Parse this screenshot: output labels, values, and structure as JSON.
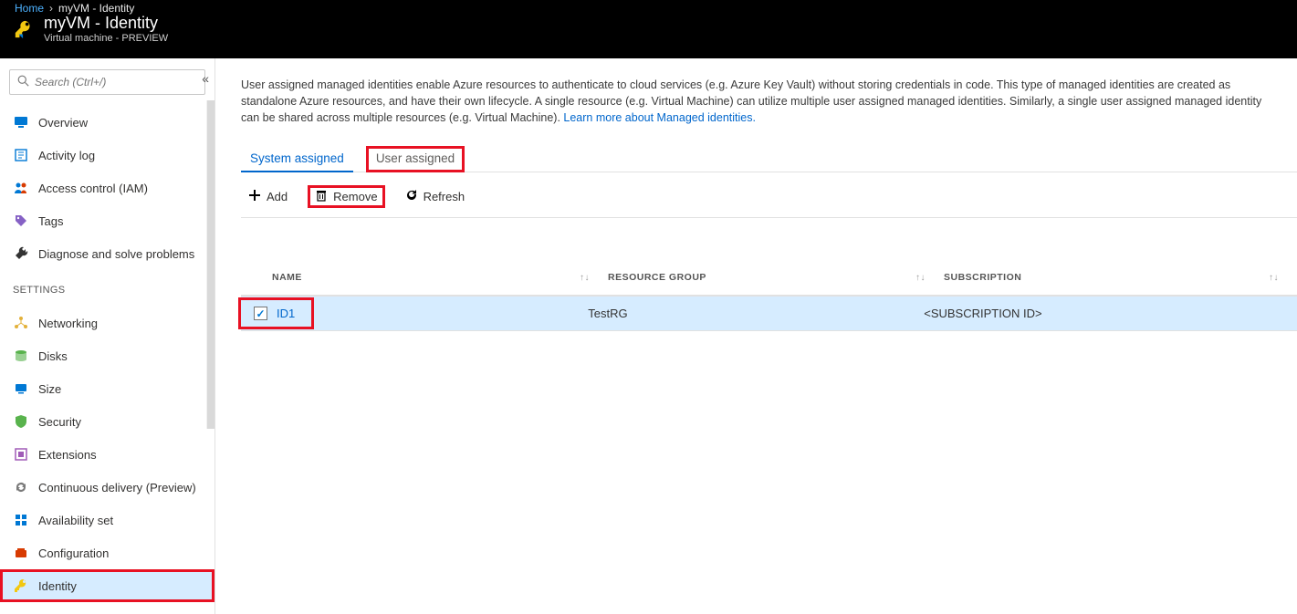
{
  "breadcrumb": {
    "home": "Home",
    "current": "myVM - Identity"
  },
  "header": {
    "title": "myVM - Identity",
    "subtitle": "Virtual machine - PREVIEW"
  },
  "search": {
    "placeholder": "Search (Ctrl+/)"
  },
  "nav": {
    "group1": [
      {
        "label": "Overview",
        "icon": "monitor-icon",
        "color": "#0078d4"
      },
      {
        "label": "Activity log",
        "icon": "log-icon",
        "color": "#0078d4"
      },
      {
        "label": "Access control (IAM)",
        "icon": "people-icon",
        "color": "#0078d4"
      },
      {
        "label": "Tags",
        "icon": "tag-icon",
        "color": "#8661c5"
      },
      {
        "label": "Diagnose and solve problems",
        "icon": "wrench-icon",
        "color": "#333333"
      }
    ],
    "settingsHeader": "SETTINGS",
    "group2": [
      {
        "label": "Networking",
        "icon": "network-icon",
        "color": "#e3b13a"
      },
      {
        "label": "Disks",
        "icon": "disks-icon",
        "color": "#59b34d"
      },
      {
        "label": "Size",
        "icon": "size-icon",
        "color": "#0078d4"
      },
      {
        "label": "Security",
        "icon": "shield-icon",
        "color": "#59b34d"
      },
      {
        "label": "Extensions",
        "icon": "ext-icon",
        "color": "#a05bb7"
      },
      {
        "label": "Continuous delivery (Preview)",
        "icon": "cd-icon",
        "color": "#7a7a7a"
      },
      {
        "label": "Availability set",
        "icon": "avail-icon",
        "color": "#0078d4"
      },
      {
        "label": "Configuration",
        "icon": "config-icon",
        "color": "#d83b01"
      },
      {
        "label": "Identity",
        "icon": "identity-icon",
        "color": "#f2c811",
        "active": true,
        "highlight": true
      }
    ]
  },
  "description": {
    "text": "User assigned managed identities enable Azure resources to authenticate to cloud services (e.g. Azure Key Vault) without storing credentials in code. This type of managed identities are created as standalone Azure resources, and have their own lifecycle. A single resource (e.g. Virtual Machine) can utilize multiple user assigned managed identities. Similarly, a single user assigned managed identity can be shared across multiple resources (e.g. Virtual Machine). ",
    "link": "Learn more about Managed identities."
  },
  "tabs": [
    {
      "label": "System assigned",
      "active": true
    },
    {
      "label": "User assigned",
      "highlight": true
    }
  ],
  "toolbar": {
    "add": "Add",
    "remove": "Remove",
    "refresh": "Refresh"
  },
  "table": {
    "headers": {
      "name": "NAME",
      "rg": "RESOURCE GROUP",
      "sub": "SUBSCRIPTION"
    },
    "rows": [
      {
        "checked": true,
        "name": "ID1",
        "rg": "TestRG",
        "sub": "<SUBSCRIPTION ID>",
        "highlight": true
      }
    ]
  }
}
